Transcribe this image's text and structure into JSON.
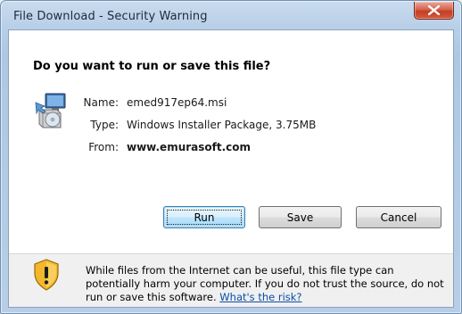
{
  "window": {
    "title": "File Download - Security Warning",
    "close_label": "X"
  },
  "dialog": {
    "question": "Do you want to run or save this file?",
    "file": {
      "name_label": "Name:",
      "name_value": "emed917ep64.msi",
      "type_label": "Type:",
      "type_value": "Windows Installer Package, 3.75MB",
      "from_label": "From:",
      "from_value": "www.emurasoft.com"
    },
    "buttons": {
      "run": "Run",
      "save": "Save",
      "cancel": "Cancel"
    },
    "warning": {
      "text_line1": "While files from the Internet can be useful, this file type can",
      "text_line2": "potentially harm your computer. If you do not trust the source, do not",
      "text_line3": "run or save this software.",
      "risk_link": "What's the risk?"
    },
    "icons": {
      "file": "installer-package-icon",
      "warning": "security-shield-icon",
      "close": "close-icon"
    },
    "colors": {
      "link": "#0a4ea8",
      "close_button": "#c23f24",
      "default_button_border": "#3c7fb1",
      "title_bar": "#b9d0e8"
    }
  }
}
